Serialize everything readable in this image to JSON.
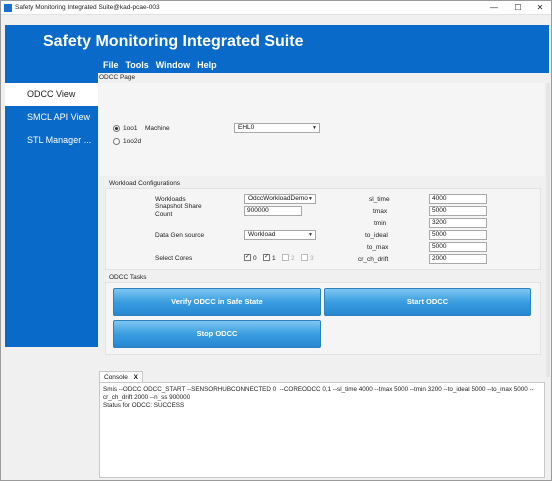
{
  "window": {
    "title": "Safety Monitoring Integrated Suite@kad-pcae-003",
    "controls": {
      "minimize": "—",
      "maximize": "☐",
      "close": "✕"
    }
  },
  "header": {
    "app_title": "Safety Monitoring Integrated Suite",
    "menu": [
      "File",
      "Tools",
      "Window",
      "Help"
    ]
  },
  "sidebar": {
    "items": [
      "ODCC View",
      "SMCL API View",
      "STL Manager ..."
    ],
    "active": "ODCC View"
  },
  "page": {
    "label": "ODCC Page",
    "mode": {
      "options": [
        "1oo1",
        "1oo2d"
      ],
      "selected": "1oo1"
    },
    "machine_label": "Machine",
    "machine_value": "EHL0"
  },
  "workload": {
    "section_label": "Workload Configurations",
    "workloads_label": "Workloads",
    "workloads_value": "OdccWorkloadDemo",
    "snapshot_label_1": "Snapshot Share",
    "snapshot_label_2": "Count",
    "snapshot_value": "900000",
    "datagen_label": "Data Gen source",
    "datagen_value": "Workload",
    "cores_label": "Select Cores",
    "cores": [
      {
        "label": "0",
        "checked": true,
        "enabled": true
      },
      {
        "label": "1",
        "checked": true,
        "enabled": true
      },
      {
        "label": "2",
        "checked": false,
        "enabled": false
      },
      {
        "label": "3",
        "checked": false,
        "enabled": false
      }
    ],
    "params": [
      {
        "label": "sl_time",
        "value": "4000"
      },
      {
        "label": "tmax",
        "value": "5000"
      },
      {
        "label": "tmin",
        "value": "3200"
      },
      {
        "label": "to_ideal",
        "value": "5000"
      },
      {
        "label": "to_max",
        "value": "5000"
      },
      {
        "label": "cr_ch_drift",
        "value": "2000"
      }
    ]
  },
  "tasks": {
    "section_label": "ODCC Tasks",
    "verify_label": "Verify ODCC in Safe State",
    "start_label": "Start ODCC",
    "stop_label": "Stop ODCC"
  },
  "console": {
    "tab_label": "Console",
    "close": "X",
    "text": "Smis --ODCC ODCC_START --SENSORHUBCONNECTED 0  --COREODCC 0,1 --sl_time 4000 --tmax 5000 --tmin 3200 --to_ideal 5000 --to_max 5000 --cr_ch_drift 2000 --n_ss 900000\nStatus for ODCC: SUCCESS"
  },
  "colors": {
    "accent": "#0a6ac9",
    "button": "#3a9de0"
  }
}
